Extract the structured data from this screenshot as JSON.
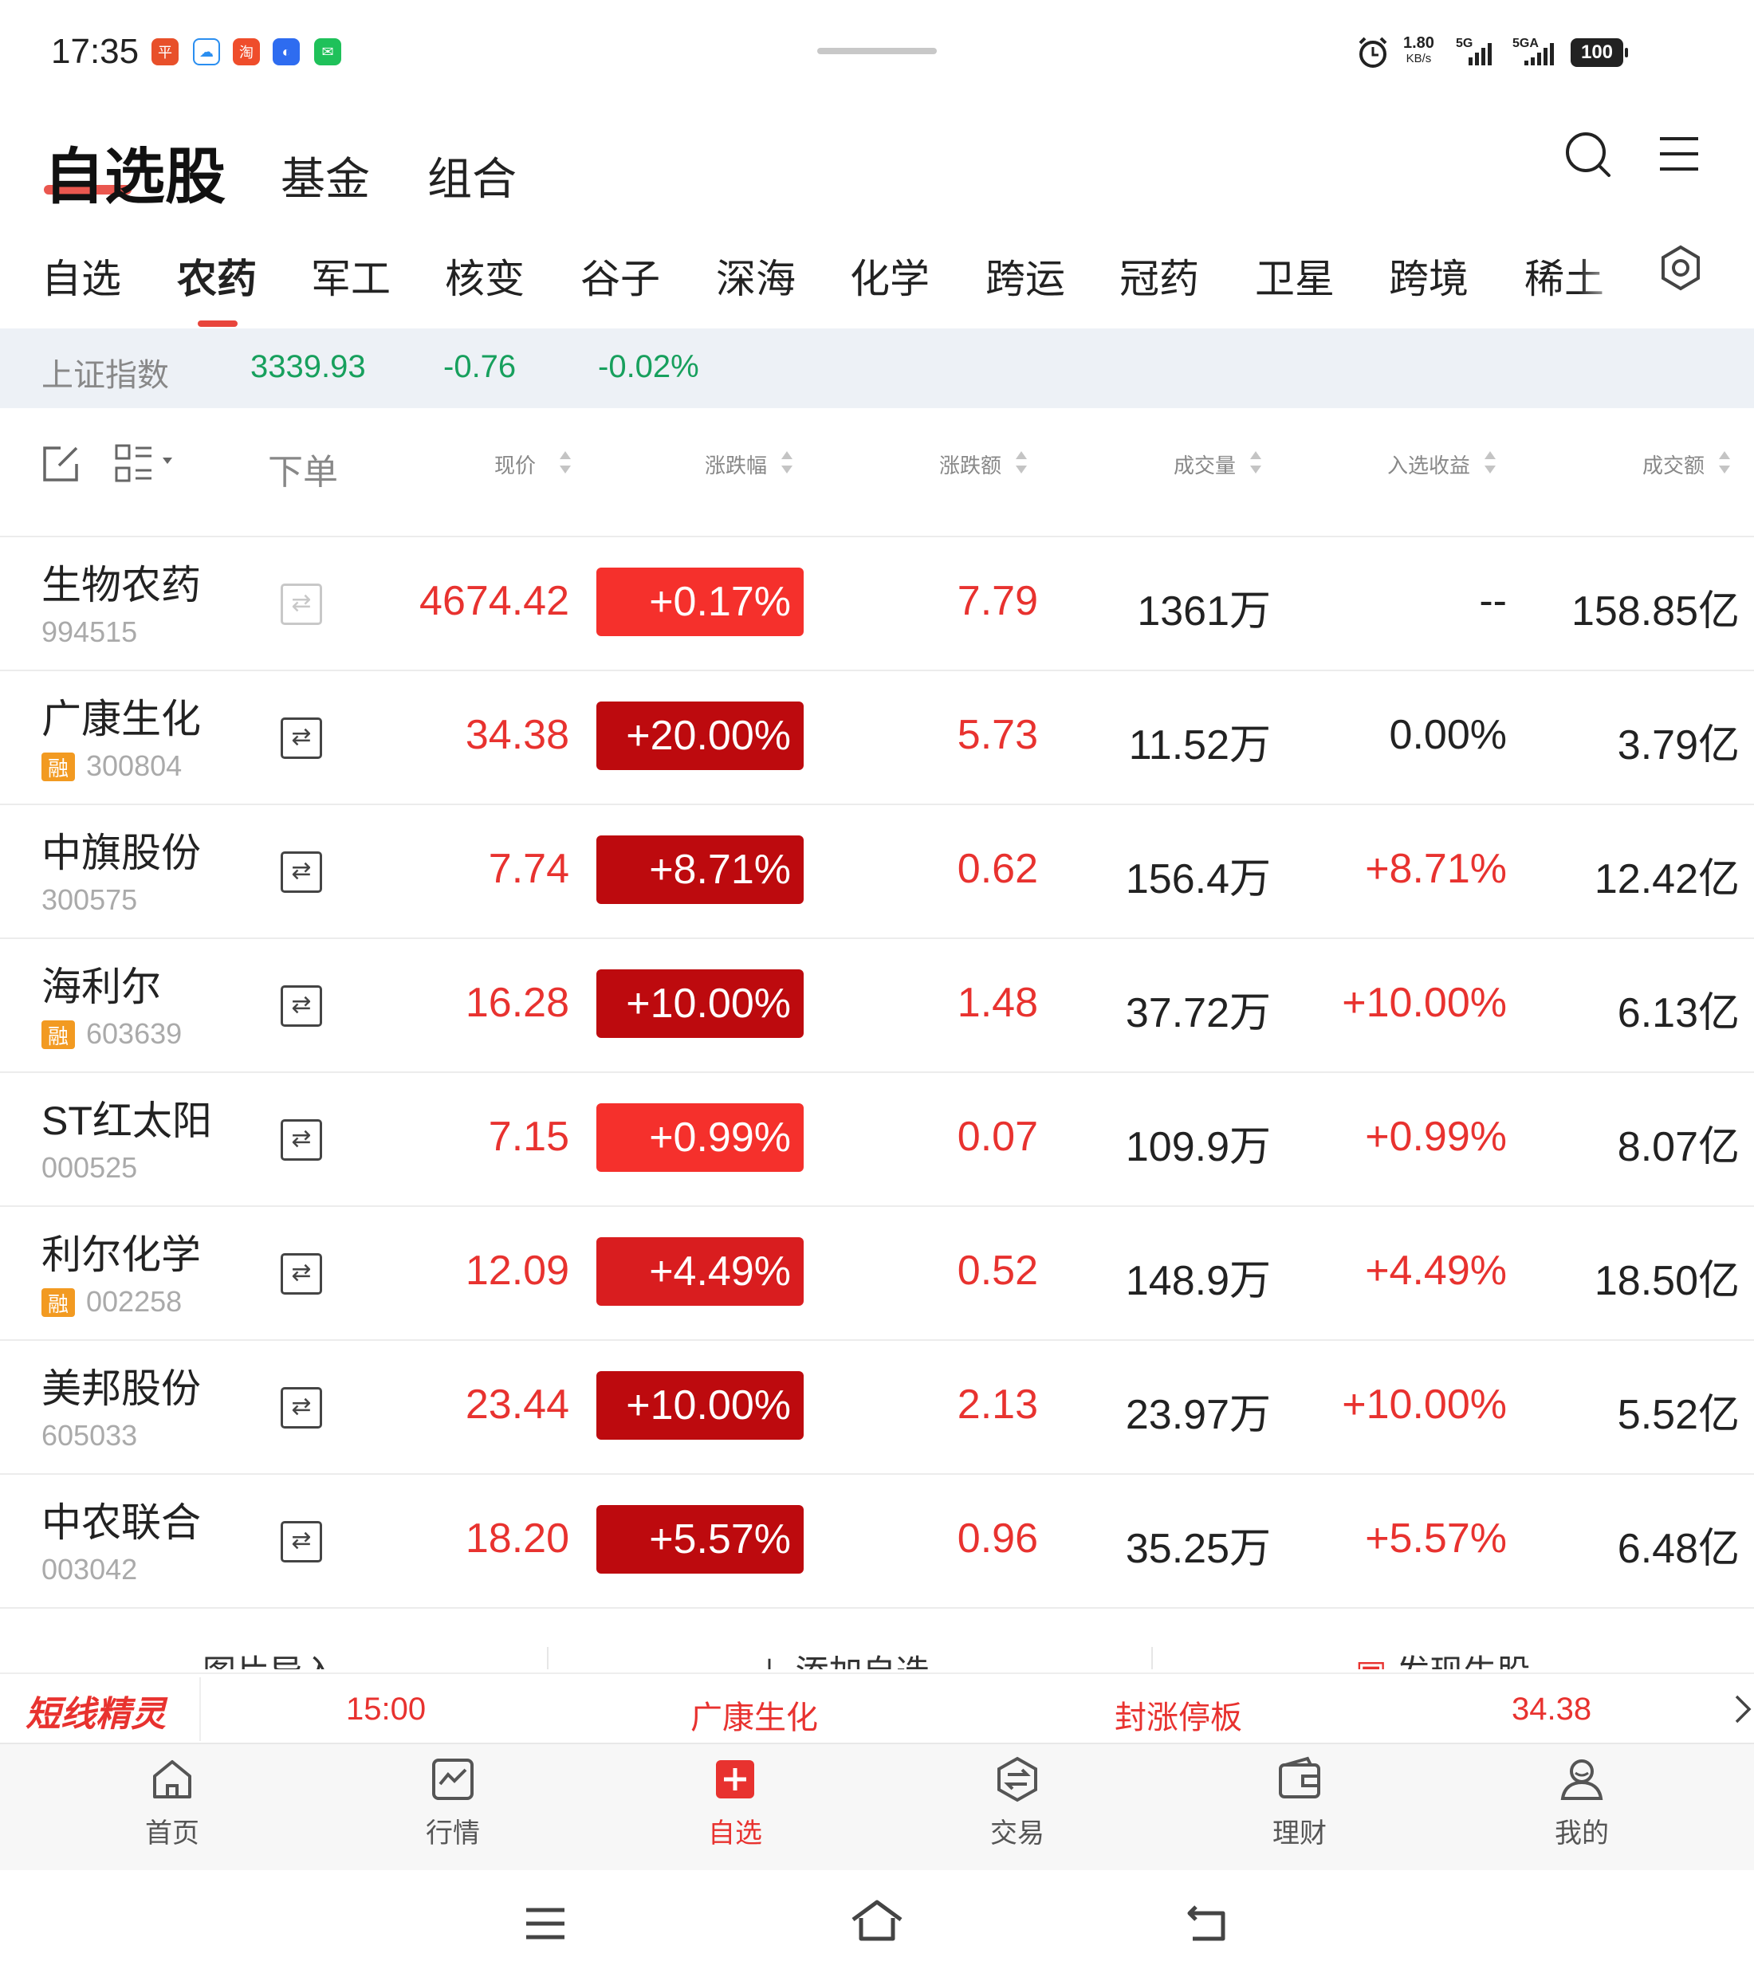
{
  "status_bar": {
    "time": "17:35",
    "net_speed_value": "1.80",
    "net_speed_unit": "KB/s",
    "signal1_label": "5G",
    "signal2_label": "5GA",
    "battery": "100"
  },
  "header": {
    "title": "自选股",
    "tabs": [
      "基金",
      "组合"
    ]
  },
  "category_tabs": [
    "自选",
    "农药",
    "军工",
    "核变",
    "谷子",
    "深海",
    "化学",
    "跨运",
    "冠药",
    "卫星",
    "跨境",
    "稀土"
  ],
  "active_category": "农药",
  "index_bar": {
    "name": "上证指数",
    "value": "3339.93",
    "change": "-0.76",
    "change_pct": "-0.02%"
  },
  "columns": {
    "order": "下单",
    "price": "现价",
    "change_pct": "涨跌幅",
    "change_amt": "涨跌额",
    "volume": "成交量",
    "gain_since_added": "入选收益",
    "amount": "成交额"
  },
  "rows": [
    {
      "name": "生物农药",
      "code": "994515",
      "margin": false,
      "price": "4674.42",
      "pct": "+0.17%",
      "pct_color": "#f5302c",
      "chg": "7.79",
      "vol": "1361万",
      "gain": "--",
      "gain_color": "#222222",
      "amt": "158.85亿",
      "trade_enabled": false
    },
    {
      "name": "广康生化",
      "code": "300804",
      "margin": true,
      "price": "34.38",
      "pct": "+20.00%",
      "pct_color": "#bd0a0e",
      "chg": "5.73",
      "vol": "11.52万",
      "gain": "0.00%",
      "gain_color": "#222222",
      "amt": "3.79亿",
      "trade_enabled": true
    },
    {
      "name": "中旗股份",
      "code": "300575",
      "margin": false,
      "price": "7.74",
      "pct": "+8.71%",
      "pct_color": "#bd0a0e",
      "chg": "0.62",
      "vol": "156.4万",
      "gain": "+8.71%",
      "gain_color": "#e8322f",
      "amt": "12.42亿",
      "trade_enabled": true
    },
    {
      "name": "海利尔",
      "code": "603639",
      "margin": true,
      "price": "16.28",
      "pct": "+10.00%",
      "pct_color": "#bd0a0e",
      "chg": "1.48",
      "vol": "37.72万",
      "gain": "+10.00%",
      "gain_color": "#e8322f",
      "amt": "6.13亿",
      "trade_enabled": true
    },
    {
      "name": "ST红太阳",
      "code": "000525",
      "margin": false,
      "price": "7.15",
      "pct": "+0.99%",
      "pct_color": "#f5302c",
      "chg": "0.07",
      "vol": "109.9万",
      "gain": "+0.99%",
      "gain_color": "#e8322f",
      "amt": "8.07亿",
      "trade_enabled": true
    },
    {
      "name": "利尔化学",
      "code": "002258",
      "margin": true,
      "price": "12.09",
      "pct": "+4.49%",
      "pct_color": "#d91d1f",
      "chg": "0.52",
      "vol": "148.9万",
      "gain": "+4.49%",
      "gain_color": "#e8322f",
      "amt": "18.50亿",
      "trade_enabled": true
    },
    {
      "name": "美邦股份",
      "code": "605033",
      "margin": false,
      "price": "23.44",
      "pct": "+10.00%",
      "pct_color": "#bd0a0e",
      "chg": "2.13",
      "vol": "23.97万",
      "gain": "+10.00%",
      "gain_color": "#e8322f",
      "amt": "5.52亿",
      "trade_enabled": true
    },
    {
      "name": "中农联合",
      "code": "003042",
      "margin": false,
      "price": "18.20",
      "pct": "+5.57%",
      "pct_color": "#bd0a0e",
      "chg": "0.96",
      "vol": "35.25万",
      "gain": "+5.57%",
      "gain_color": "#e8322f",
      "amt": "6.48亿",
      "trade_enabled": true
    }
  ],
  "margin_badge": "融",
  "footer_actions": [
    "图片导入",
    "添加自选",
    "发现牛股"
  ],
  "ticker": {
    "label": "短线精灵",
    "time": "15:00",
    "stock": "广康生化",
    "event": "封涨停板",
    "price": "34.38"
  },
  "bottom_nav": [
    "首页",
    "行情",
    "自选",
    "交易",
    "理财",
    "我的"
  ],
  "active_nav": "自选",
  "colors": {
    "up": "#e8322f",
    "down": "#17a05d",
    "accent": "#e8453c"
  }
}
